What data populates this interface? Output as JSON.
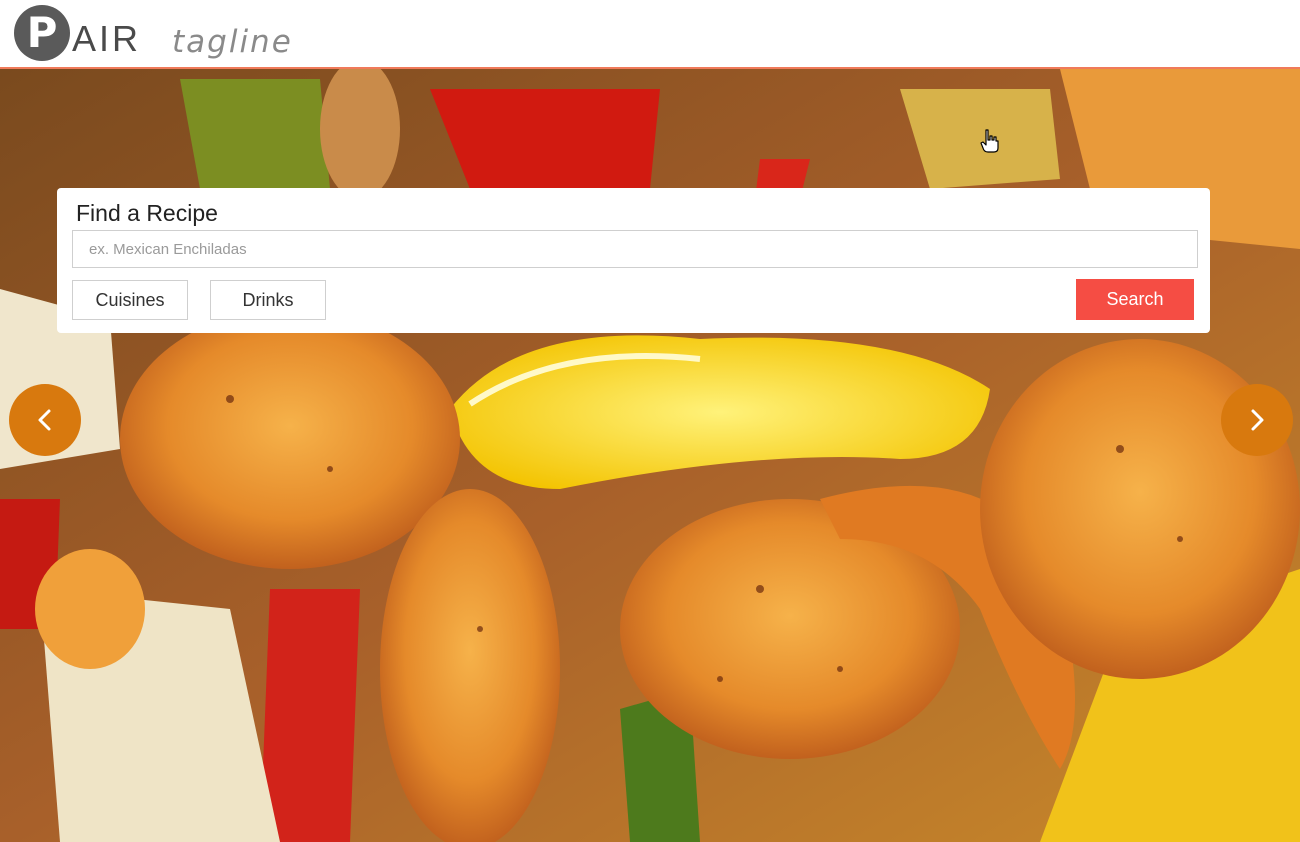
{
  "brand": {
    "logo_letter": "P",
    "logo_rest": "AIR",
    "tagline": "tagline"
  },
  "search_card": {
    "title": "Find a Recipe",
    "input_placeholder": "ex. Mexican Enchiladas",
    "input_value": "",
    "cuisines_label": "Cuisines",
    "drinks_label": "Drinks",
    "search_label": "Search"
  },
  "carousel": {
    "prev_icon": "chevron-left-icon",
    "next_icon": "chevron-right-icon"
  },
  "colors": {
    "accent_red": "#f54d44",
    "arrow_orange": "#d8790e",
    "header_border": "#f07a5a",
    "logo_gray": "#5a5a5a"
  }
}
